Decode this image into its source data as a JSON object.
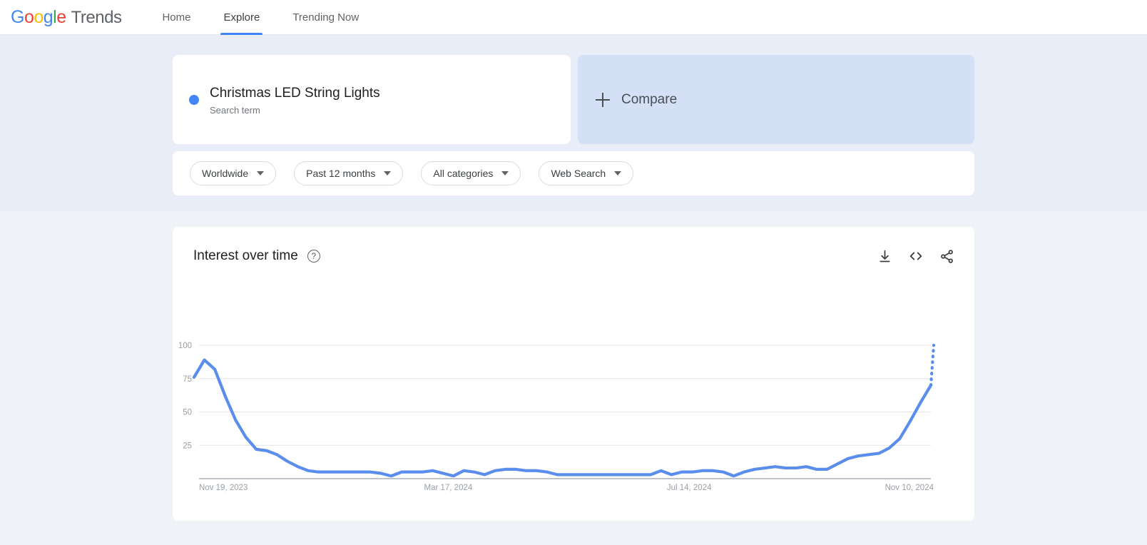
{
  "header": {
    "logo": {
      "google": "Google",
      "trends": "Trends"
    },
    "nav": [
      {
        "label": "Home",
        "active": false
      },
      {
        "label": "Explore",
        "active": true
      },
      {
        "label": "Trending Now",
        "active": false
      }
    ]
  },
  "query": {
    "term": {
      "title": "Christmas LED String Lights",
      "subtitle": "Search term",
      "color": "#4285F4"
    },
    "compare": {
      "label": "Compare",
      "icon": "plus-icon"
    }
  },
  "filters": [
    {
      "label": "Worldwide",
      "name": "location-filter"
    },
    {
      "label": "Past 12 months",
      "name": "time-filter"
    },
    {
      "label": "All categories",
      "name": "category-filter"
    },
    {
      "label": "Web Search",
      "name": "search-type-filter"
    }
  ],
  "chart_card": {
    "title": "Interest over time",
    "help_icon": "?",
    "actions": [
      {
        "name": "download-icon"
      },
      {
        "name": "embed-code-icon"
      },
      {
        "name": "share-icon"
      }
    ]
  },
  "chart_data": {
    "type": "line",
    "title": "Interest over time",
    "xlabel": "",
    "ylabel": "",
    "ylim": [
      0,
      100
    ],
    "yticks": [
      25,
      50,
      75,
      100
    ],
    "xticks": [
      "Nov 19, 2023",
      "Mar 17, 2024",
      "Jul 14, 2024",
      "Nov 10, 2024"
    ],
    "grid": true,
    "legend": false,
    "line_color": "#5b8ded",
    "series": [
      {
        "name": "Christmas LED String Lights",
        "values": [
          76,
          89,
          82,
          62,
          44,
          31,
          22,
          21,
          18,
          13,
          9,
          6,
          5,
          5,
          5,
          5,
          5,
          5,
          4,
          2,
          5,
          5,
          5,
          6,
          4,
          2,
          6,
          5,
          3,
          6,
          7,
          7,
          6,
          6,
          5,
          3,
          3,
          3,
          3,
          3,
          3,
          3,
          3,
          3,
          3,
          6,
          3,
          5,
          5,
          6,
          6,
          5,
          2,
          5,
          7,
          8,
          9,
          8,
          8,
          9,
          7,
          7,
          11,
          15,
          17,
          18,
          19,
          23,
          30,
          43,
          57,
          70
        ],
        "partial_tail": {
          "from": 70,
          "to": 100,
          "style": "dotted"
        }
      }
    ]
  }
}
